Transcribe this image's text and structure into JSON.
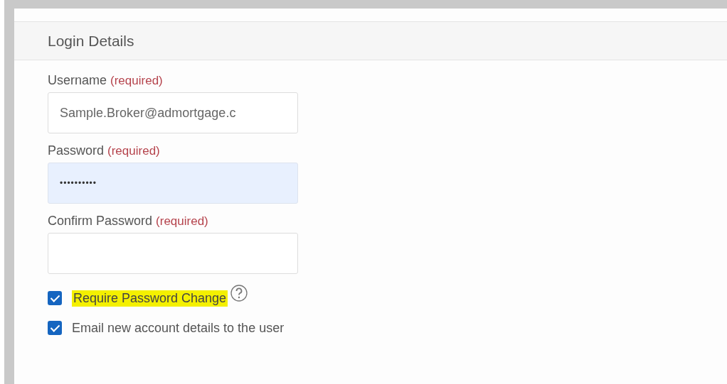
{
  "section": {
    "title": "Login Details"
  },
  "fields": [
    {
      "label": "Username",
      "note": "(required)",
      "value": "Sample.Broker@admortgage.c",
      "autofilled": false
    },
    {
      "label": "Password",
      "note": "(required)",
      "value": "••••••••••",
      "autofilled": true
    },
    {
      "label": "Confirm Password",
      "note": "(required)",
      "autofilled": false
    }
  ],
  "checkboxes": [
    {
      "label": "Require Password Change",
      "checked": true,
      "highlighted": true,
      "help": true
    },
    {
      "label": "Email new account details to the user",
      "checked": true,
      "highlighted": false,
      "help": false
    }
  ]
}
